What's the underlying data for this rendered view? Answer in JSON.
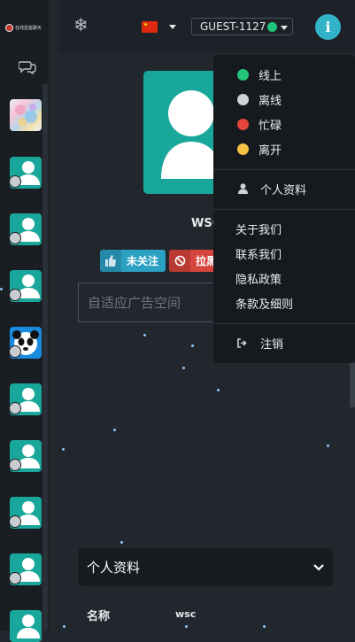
{
  "sidebar": {
    "logo_text": "在线星座聊天",
    "avatars": [
      "flower",
      "teal",
      "teal",
      "teal",
      "panda",
      "teal",
      "teal",
      "teal",
      "teal",
      "teal"
    ]
  },
  "header": {
    "username": "GUEST-1127",
    "status_color": "#22c47a",
    "info_label": "i"
  },
  "profile": {
    "name": "WSC",
    "follow_label": "未关注",
    "block_label": "拉黑",
    "ad_placeholder": "自适应广告空间"
  },
  "section": {
    "title": "个人资料",
    "field_label": "名称",
    "field_value": "wsc"
  },
  "menu": {
    "statuses": [
      {
        "label": "线上",
        "color": "#22c47a"
      },
      {
        "label": "离线",
        "color": "#cfd2d6"
      },
      {
        "label": "忙碌",
        "color": "#e5443b"
      },
      {
        "label": "离开",
        "color": "#f7c142"
      }
    ],
    "profile_label": "个人资料",
    "links": [
      "关于我们",
      "联系我们",
      "隐私政策",
      "条款及细则"
    ],
    "logout_label": "注销"
  },
  "colors": {
    "accent": "#32b4c8",
    "teal_avatar": "#1aa79b",
    "follow": "#2aa0c2",
    "block": "#d6453d"
  }
}
